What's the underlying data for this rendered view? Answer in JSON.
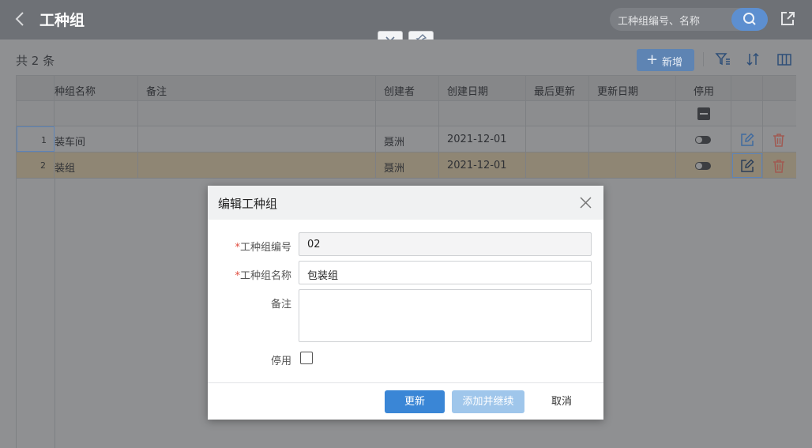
{
  "header": {
    "title": "工种组",
    "search_placeholder": "工种组编号、名称"
  },
  "toolbar": {
    "count_text": "共 2 条",
    "add_label": "新增"
  },
  "table": {
    "columns": [
      "种组名称",
      "备注",
      "创建者",
      "创建日期",
      "最后更新",
      "更新日期",
      "停用"
    ],
    "rows": [
      {
        "index": "1",
        "name": "装车间",
        "remark": "",
        "creator": "聂洲",
        "created": "2021-12-01",
        "last_updated_by": "",
        "updated": ""
      },
      {
        "index": "2",
        "name": "装组",
        "remark": "",
        "creator": "聂洲",
        "created": "2021-12-01",
        "last_updated_by": "",
        "updated": ""
      }
    ]
  },
  "modal": {
    "title": "编辑工种组",
    "required_mark": "*",
    "code_label": "工种组编号",
    "code_value": "02",
    "name_label": "工种组名称",
    "name_value": "包装组",
    "remark_label": "备注",
    "disable_label": "停用",
    "update_label": "更新",
    "add_continue_label": "添加并继续",
    "cancel_label": "取消"
  },
  "colors": {
    "primary": "#3a86d6",
    "primary_disabled": "#9fc6eb",
    "required": "#e04b3d",
    "delete_icon": "#d9534f"
  }
}
